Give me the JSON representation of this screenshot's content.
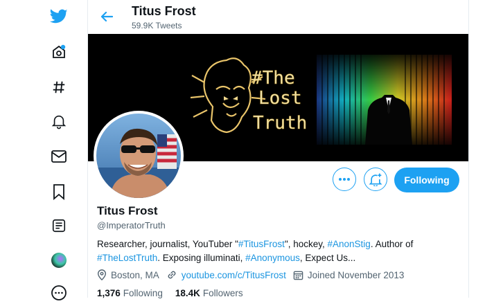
{
  "header": {
    "name": "Titus Frost",
    "tweet_count": "59.9K Tweets"
  },
  "banner": {
    "line1": "#The",
    "line2": "Lost",
    "line3": "Truth"
  },
  "profile": {
    "name": "Titus Frost",
    "handle": "@ImperatorTruth",
    "bio": {
      "p1": "Researcher, journalist, YouTuber \"",
      "tag1": "#TitusFrost",
      "p2": "\", hockey, ",
      "tag2": "#AnonStig",
      "p3": ". Author of ",
      "tag3": "#TheLostTruth",
      "p4": ". Exposing illuminati, ",
      "tag4": "#Anonymous",
      "p5": ", Expect Us..."
    },
    "location": "Boston, MA",
    "website": "youtube.com/c/TitusFrost",
    "joined": "Joined November 2013",
    "following_count": "1,376",
    "following_label": "Following",
    "followers_count": "18.4K",
    "followers_label": "Followers"
  },
  "actions": {
    "follow_label": "Following"
  },
  "colors": {
    "accent": "#1da1f2",
    "link": "#1b95e0",
    "muted": "#536471"
  }
}
